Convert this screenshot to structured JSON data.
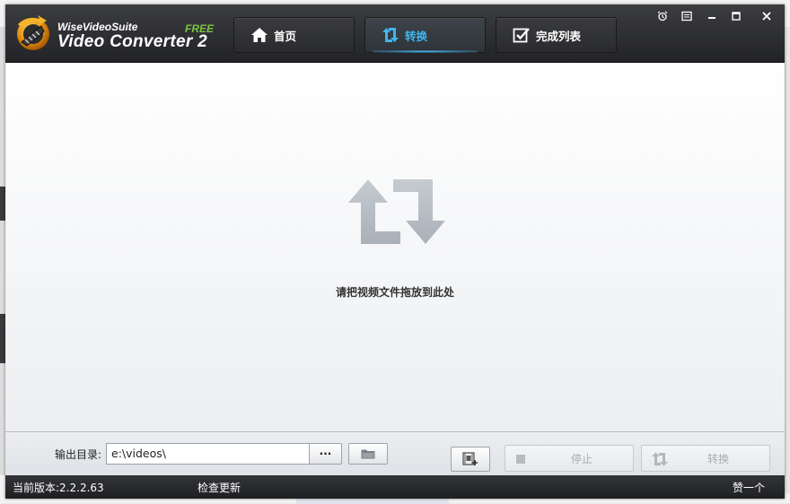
{
  "app": {
    "brand": "WiseVideoSuite",
    "free_badge": "FREE",
    "product": "Video Converter 2"
  },
  "tabs": [
    {
      "label": "首页",
      "icon": "home-icon",
      "active": false
    },
    {
      "label": "转换",
      "icon": "convert-icon",
      "active": true
    },
    {
      "label": "完成列表",
      "icon": "checklist-icon",
      "active": false
    }
  ],
  "window_controls": [
    "alarm-icon",
    "menu-icon",
    "minimize-icon",
    "maximize-icon",
    "close-icon"
  ],
  "main": {
    "drop_hint": "请把视频文件拖放到此处"
  },
  "output": {
    "label": "输出目录:",
    "path": "e:\\videos\\",
    "browse_label": "···"
  },
  "actions": {
    "stop_label": "停止",
    "convert_label": "转换"
  },
  "status": {
    "version": "当前版本:2.2.2.63",
    "check_update": "检查更新",
    "like": "赞一个"
  },
  "colors": {
    "accent": "#3fb6f0",
    "titlebar": "#2a2b2e",
    "free": "#7bc242"
  }
}
